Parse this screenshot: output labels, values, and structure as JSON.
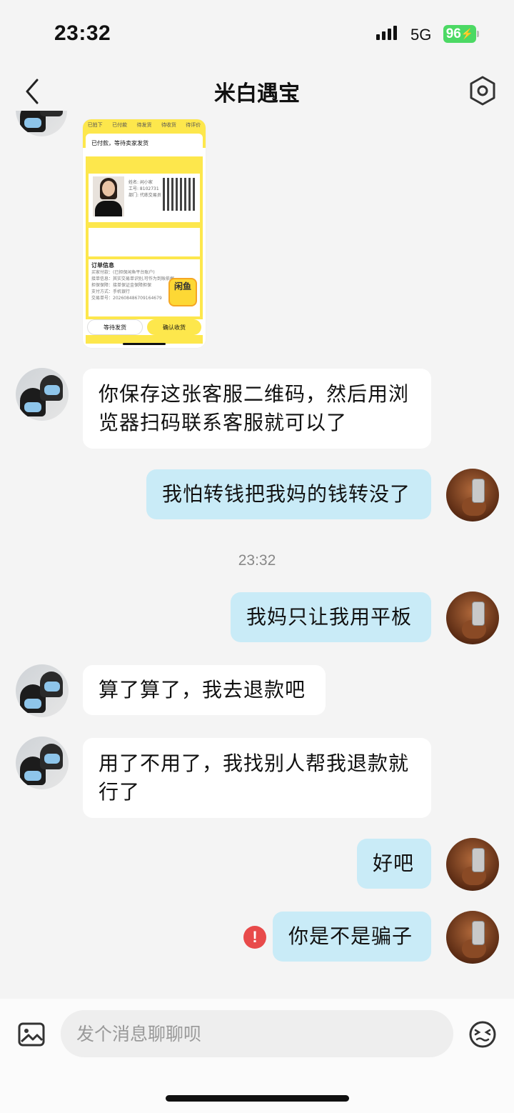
{
  "status_bar": {
    "time": "23:32",
    "network": "5G",
    "battery": "96"
  },
  "nav": {
    "title": "米白遇宝",
    "back_icon": "chevron-left-icon",
    "settings_icon": "settings-hexagon-icon"
  },
  "image_message": {
    "tabs": [
      "已拍下",
      "已付款",
      "待发货",
      "待收货",
      "待评价"
    ],
    "status_text": "已付款，等待卖家发货",
    "id_name": "姓名: 闲小家",
    "id_number": "工号: 8102731",
    "id_dept": "部门: 代练交易员",
    "order_title": "订单信息",
    "order_lines": [
      "买家付款：(已担保闲鱼平台账户)",
      "接单信息：其实交易单识别,可作为到账依据",
      "担保保障：接单保证金保障担保",
      "支付方式：手机银行",
      "交易单号：202608486709164679"
    ],
    "logo_text": "闲鱼",
    "button_wait": "等待发货",
    "button_confirm": "确认收货"
  },
  "messages": [
    {
      "side": "left",
      "text": "你保存这张客服二维码，然后用浏览器扫码联系客服就可以了"
    },
    {
      "side": "right",
      "text": "我怕转钱把我妈的钱转没了"
    },
    {
      "side": "right",
      "text": "我妈只让我用平板"
    },
    {
      "side": "left",
      "text": "算了算了，我去退款吧"
    },
    {
      "side": "left",
      "text": "用了不用了，我找别人帮我退款就行了"
    },
    {
      "side": "right",
      "text": "好吧"
    },
    {
      "side": "right",
      "text": "你是不是骗子",
      "error": true
    }
  ],
  "timestamp": "23:32",
  "input": {
    "placeholder": "发个消息聊聊呗",
    "image_icon": "image-icon",
    "emoji_icon": "emoji-icon"
  }
}
